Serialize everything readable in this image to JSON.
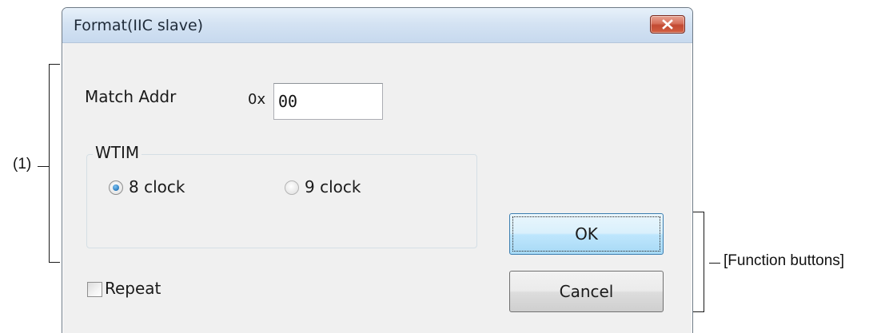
{
  "dialog": {
    "title": "Format(IIC slave)",
    "close_icon": "close-icon"
  },
  "match_addr": {
    "label": "Match Addr",
    "prefix": "0x",
    "value": "00"
  },
  "wtim": {
    "caption": "WTIM",
    "options": [
      {
        "label": "8 clock",
        "checked": true
      },
      {
        "label": "9 clock",
        "checked": false
      }
    ]
  },
  "repeat": {
    "label": "Repeat",
    "checked": false
  },
  "buttons": {
    "ok": "OK",
    "cancel": "Cancel"
  },
  "annotations": {
    "area_label": "(1)",
    "function_buttons_label": "[Function buttons]"
  },
  "colors": {
    "close_button": "#c24a32",
    "default_button": "#a7d9f5",
    "radio_dot": "#1c6fb5"
  }
}
